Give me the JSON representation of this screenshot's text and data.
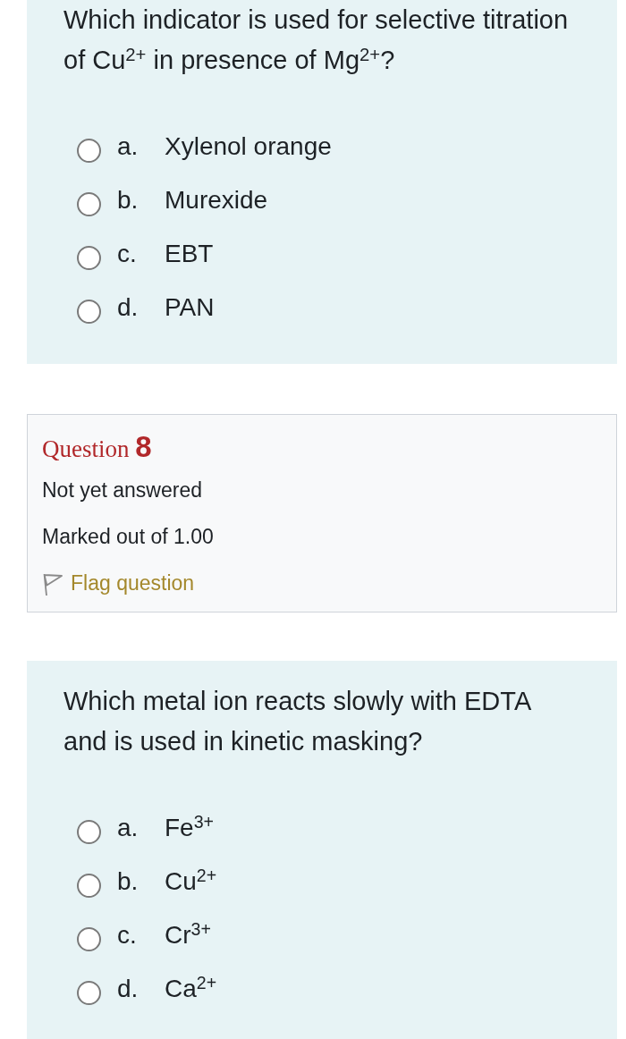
{
  "sections": [
    {
      "kind": "formulation",
      "text": "Which indicator is used for selective titration of Cu$^{2+}$ in presence of Mg$^{2+}$?",
      "options": [
        {
          "letter": "a.",
          "text": "Xylenol orange",
          "selected": false
        },
        {
          "letter": "b.",
          "text": "Murexide",
          "selected": false
        },
        {
          "letter": "c.",
          "text": "EBT",
          "selected": false
        },
        {
          "letter": "d.",
          "text": "PAN",
          "selected": false
        }
      ]
    },
    {
      "kind": "info",
      "title": "Question **8**",
      "status": "Not yet answered",
      "marks": "Marked out of 1.00",
      "flag": {
        "label": "Flag question",
        "flagged": false
      }
    },
    {
      "kind": "formulation",
      "text": "Which metal ion reacts slowly with EDTA and is used in kinetic masking?",
      "options": [
        {
          "letter": "a.",
          "text": "Fe$^{3+}$",
          "selected": false
        },
        {
          "letter": "b.",
          "text": "Cu$^{2+}$",
          "selected": false
        },
        {
          "letter": "c.",
          "text": "Cr$^{3+}$",
          "selected": false
        },
        {
          "letter": "d.",
          "text": "Ca$^{2+}$",
          "selected": false
        }
      ]
    }
  ]
}
